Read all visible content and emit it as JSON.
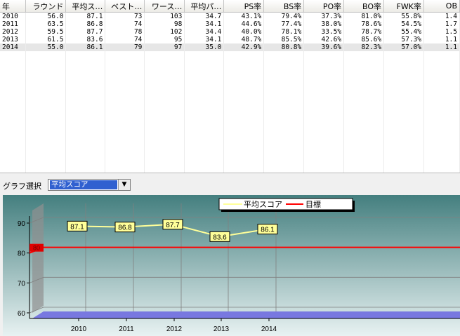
{
  "table": {
    "columns": [
      "年",
      "ラウンド",
      "平均ス…",
      "ベスト…",
      "ワース…",
      "平均パ…",
      "PS率",
      "BS率",
      "PO率",
      "BO率",
      "FWK率",
      "OB"
    ],
    "rows": [
      [
        "2010",
        "56.0",
        "87.1",
        "73",
        "103",
        "34.7",
        "43.1%",
        "79.4%",
        "37.3%",
        "81.0%",
        "55.8%",
        "1.4"
      ],
      [
        "2011",
        "63.5",
        "86.8",
        "74",
        "98",
        "34.1",
        "44.6%",
        "77.4%",
        "38.0%",
        "78.6%",
        "54.5%",
        "1.7"
      ],
      [
        "2012",
        "59.5",
        "87.7",
        "78",
        "102",
        "34.4",
        "40.0%",
        "78.1%",
        "33.5%",
        "78.7%",
        "55.4%",
        "1.5"
      ],
      [
        "2013",
        "61.5",
        "83.6",
        "74",
        "95",
        "34.1",
        "48.7%",
        "85.5%",
        "42.6%",
        "85.6%",
        "57.3%",
        "1.1"
      ],
      [
        "2014",
        "55.0",
        "86.1",
        "79",
        "97",
        "35.0",
        "42.9%",
        "80.8%",
        "39.6%",
        "82.3%",
        "57.0%",
        "1.1"
      ]
    ],
    "selected_row": 4
  },
  "graph_select": {
    "label": "グラフ選択",
    "value": "平均スコア"
  },
  "chart_data": {
    "type": "line",
    "categories": [
      "2010",
      "2011",
      "2012",
      "2013",
      "2014"
    ],
    "series": [
      {
        "name": "平均スコア",
        "values": [
          87.1,
          86.8,
          87.7,
          83.6,
          86.1
        ],
        "color": "#ffff99"
      }
    ],
    "target": {
      "name": "目標",
      "value": 80,
      "label": "80",
      "color": "#ff0000"
    },
    "ylim": [
      60,
      90
    ],
    "yticks": [
      60,
      70,
      80,
      90
    ],
    "legend_position": "top-center",
    "grid": true,
    "colors": {
      "bg_top": "#447f7f",
      "bg_bottom": "#e8f2f2",
      "floor": "#7878e0",
      "wall": "#909090"
    }
  }
}
